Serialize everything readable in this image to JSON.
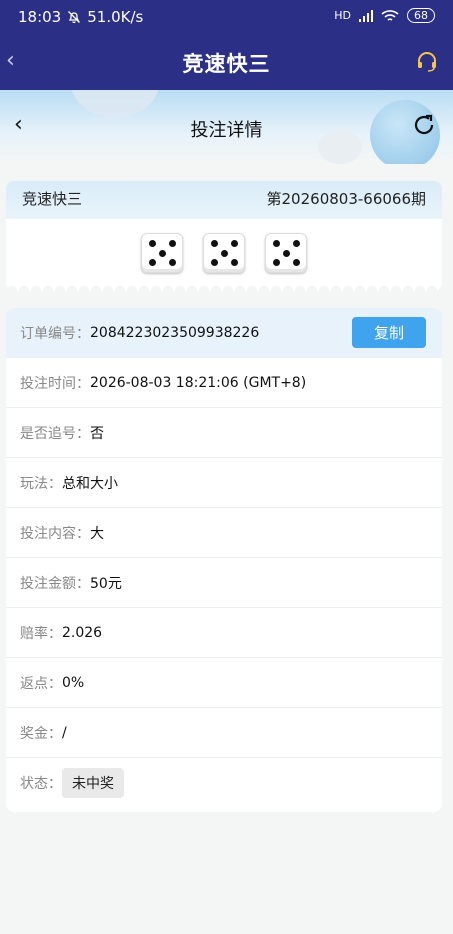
{
  "status_bar": {
    "time": "18:03",
    "speed": "51.0K/s",
    "network": "HD",
    "battery": "68"
  },
  "app_bar": {
    "title": "竞速快三"
  },
  "sub_header": {
    "title": "投注详情"
  },
  "draw": {
    "game": "竞速快三",
    "issue": "第20260803-66066期",
    "dice": [
      5,
      5,
      5
    ]
  },
  "details": {
    "order_no": {
      "label": "订单编号：",
      "value": "2084223023509938226",
      "button": "复制"
    },
    "rows": [
      {
        "label": "投注时间：",
        "value": "2026-08-03 18:21:06 (GMT+8)"
      },
      {
        "label": "是否追号：",
        "value": "否"
      },
      {
        "label": "玩法：",
        "value": "总和大小"
      },
      {
        "label": "投注内容：",
        "value": "大"
      },
      {
        "label": "投注金额：",
        "value": "50元"
      },
      {
        "label": "赔率：",
        "value": "2.026"
      },
      {
        "label": "返点：",
        "value": "0%"
      },
      {
        "label": "奖金：",
        "value": "/"
      }
    ],
    "status": {
      "label": "状态：",
      "value": "未中奖"
    }
  }
}
